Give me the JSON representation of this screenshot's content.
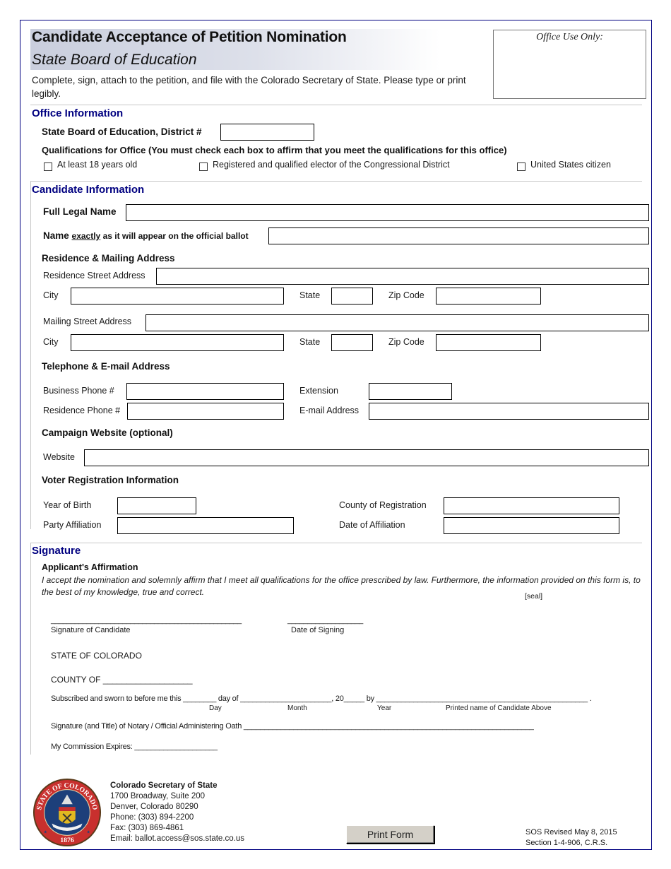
{
  "header": {
    "title": "Candidate Acceptance of Petition Nomination",
    "subtitle": "State Board of Education",
    "intro": "Complete, sign, attach to the petition, and file with the Colorado Secretary of State. Please type or print legibly.",
    "office_use_label": "Office Use Only:"
  },
  "office_info": {
    "heading": "Office Information",
    "district_label": "State Board of Education, District #",
    "district_value": "",
    "qualifications_label": "Qualifications for Office (You must check each box to affirm that you meet the qualifications for this office)",
    "qualifications": [
      {
        "label": "At least 18 years old",
        "checked": false
      },
      {
        "label": "Registered and qualified elector of the Congressional District",
        "checked": false
      },
      {
        "label": "United States citizen",
        "checked": false
      }
    ]
  },
  "candidate_info": {
    "heading": "Candidate Information",
    "full_legal_name_label": "Full Legal Name",
    "ballot_name_label_pre": "Name ",
    "ballot_name_label_em": "exactly",
    "ballot_name_label_post": " as it will appear on the official ballot",
    "address_heading": "Residence & Mailing Address",
    "residence_street_label": "Residence Street Address",
    "mailing_street_label": "Mailing Street Address",
    "city_label": "City",
    "state_label": "State",
    "zip_label": "Zip Code",
    "phone_heading": "Telephone & E-mail Address",
    "business_phone_label": "Business Phone #",
    "extension_label": "Extension",
    "residence_phone_label": "Residence Phone #",
    "email_label": "E-mail Address",
    "website_heading": "Campaign Website (optional)",
    "website_label": "Website",
    "voter_heading": "Voter Registration Information",
    "year_of_birth_label": "Year of Birth",
    "county_label": "County of Registration",
    "party_label": "Party Affiliation",
    "date_affiliation_label": "Date of Affiliation"
  },
  "signature": {
    "heading": "Signature",
    "affirmation_heading": "Applicant's Affirmation",
    "affirmation_text": "I accept the nomination and solemnly affirm that I meet all qualifications for the office prescribed by law. Furthermore, the information provided on this form is, to the best of my knowledge, true and correct.",
    "seal_label": "[seal]",
    "sig_line": "________________________________________________",
    "date_line": "___________________",
    "signature_of_candidate": "Signature of Candidate",
    "date_of_signing": "Date of Signing",
    "state_line": "STATE OF COLORADO",
    "county_line": "COUNTY OF ___________________",
    "sworn_line": "Subscribed and sworn to before me this ________ day of ______________________, 20_____ by ___________________________________________________ .",
    "sworn_day": "Day",
    "sworn_month": "Month",
    "sworn_year": "Year",
    "sworn_printed": "Printed name of Candidate Above",
    "notary_line": "Signature (and Title) of Notary / Official Administering Oath ______________________________________________________________________",
    "commission_line": "My Commission Expires: ____________________"
  },
  "footer": {
    "org": "Colorado Secretary of State",
    "address1": "1700 Broadway, Suite 200",
    "address2": "Denver, Colorado 80290",
    "phone": "Phone: (303) 894-2200",
    "fax": "Fax: (303) 869-4861",
    "email": "Email: ballot.access@sos.state.co.us",
    "print_button": "Print Form",
    "revised": "SOS Revised May 8, 2015",
    "section": "Section 1-4-906, C.R.S.",
    "seal_top_text": "STATE OF COLORADO",
    "seal_year": "1876"
  },
  "colors": {
    "section_heading": "#000080",
    "page_border": "#000080",
    "seal_red": "#c8302e",
    "seal_blue": "#1d3f7a"
  }
}
